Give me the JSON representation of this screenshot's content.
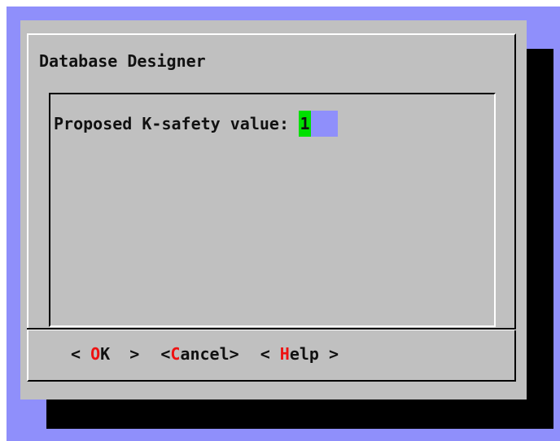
{
  "dialog": {
    "title": "Database Designer",
    "prompt_label": "Proposed K-safety value:",
    "input_value": "1"
  },
  "buttons": {
    "ok": {
      "open": "< ",
      "hotkey": "O",
      "rest": "K ",
      "close": " >"
    },
    "cancel": {
      "open": "<",
      "hotkey": "C",
      "rest": "ancel",
      "close": ">"
    },
    "help": {
      "open": "< ",
      "hotkey": "H",
      "rest": "elp",
      "close": " >"
    }
  },
  "colors": {
    "screen_background": "#8f8ffb",
    "dialog_background": "#c0c0c0",
    "input_background": "#8f8ffb",
    "cursor_highlight": "#00e000",
    "hotkey": "#ee1111"
  }
}
